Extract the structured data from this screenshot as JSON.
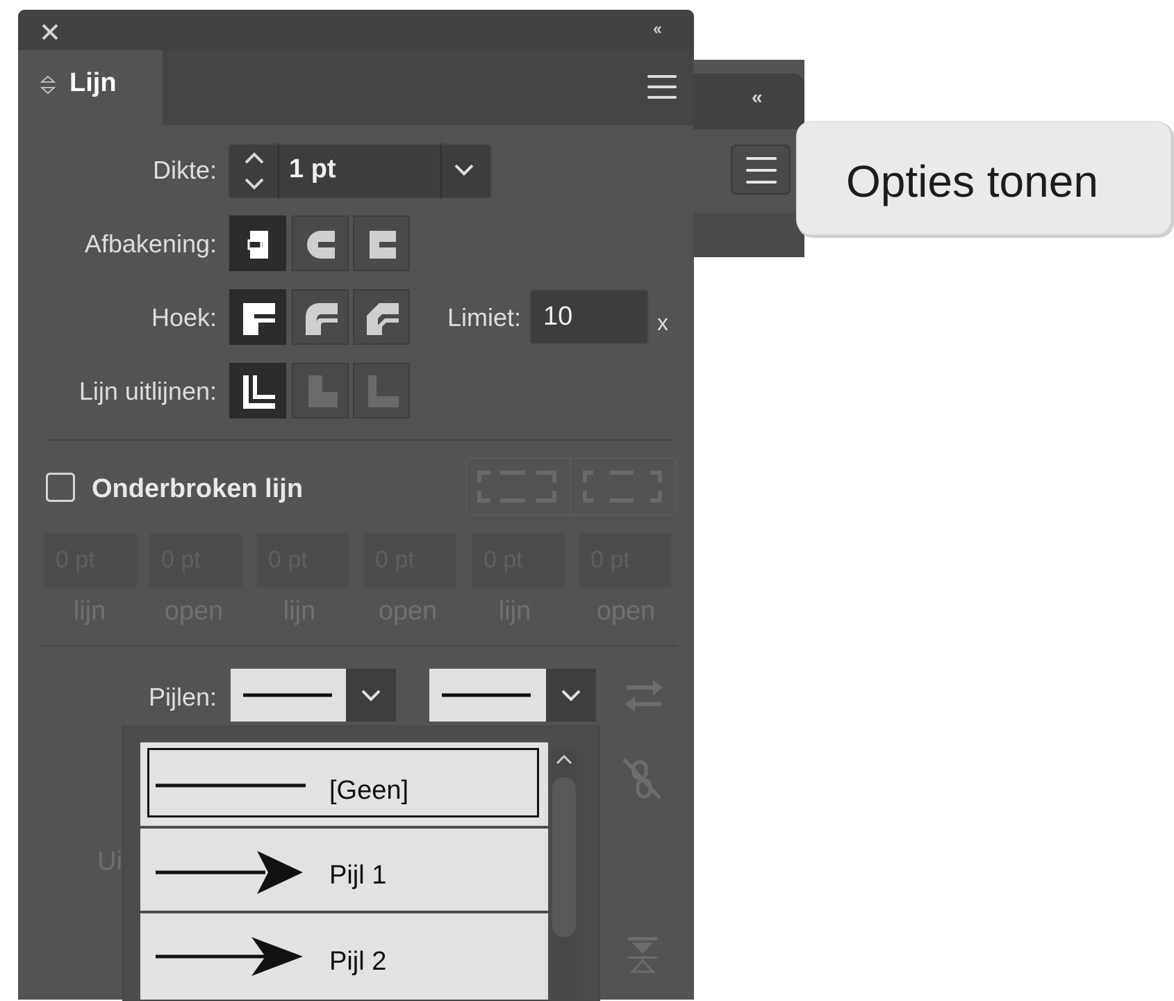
{
  "panel": {
    "tab_label": "Lijn",
    "stroke": {
      "weight_label": "Dikte:",
      "weight_value": "1 pt",
      "cap_label": "Afbakening:",
      "join_label": "Hoek:",
      "miter_label": "Limiet:",
      "miter_value": "10",
      "miter_unit": "x",
      "align_label": "Lijn uitlijnen:"
    },
    "dashed": {
      "label": "Onderbroken lijn",
      "checked": false,
      "fields": [
        {
          "value": "0 pt",
          "label": "lijn"
        },
        {
          "value": "0 pt",
          "label": "open"
        },
        {
          "value": "0 pt",
          "label": "lijn"
        },
        {
          "value": "0 pt",
          "label": "open"
        },
        {
          "value": "0 pt",
          "label": "lijn"
        },
        {
          "value": "0 pt",
          "label": "open"
        }
      ]
    },
    "arrows": {
      "label": "Pijlen:",
      "hidden_label_fragment": "Ui",
      "options": [
        "[Geen]",
        "Pijl 1",
        "Pijl 2"
      ],
      "selected": "[Geen]"
    }
  },
  "second_panel": {
    "tooltip": "Opties tonen"
  },
  "colors": {
    "panel_bg": "#535353",
    "header_bg": "#424242",
    "dropdown_item_bg": "#e2e2e2",
    "tooltip_bg": "#e8eaec"
  },
  "icons": [
    "close-icon",
    "collapse-icon",
    "panel-menu-icon",
    "stepper-icon",
    "chevron-down-icon",
    "swap-arrows-icon",
    "unlink-icon",
    "scale-icon"
  ]
}
